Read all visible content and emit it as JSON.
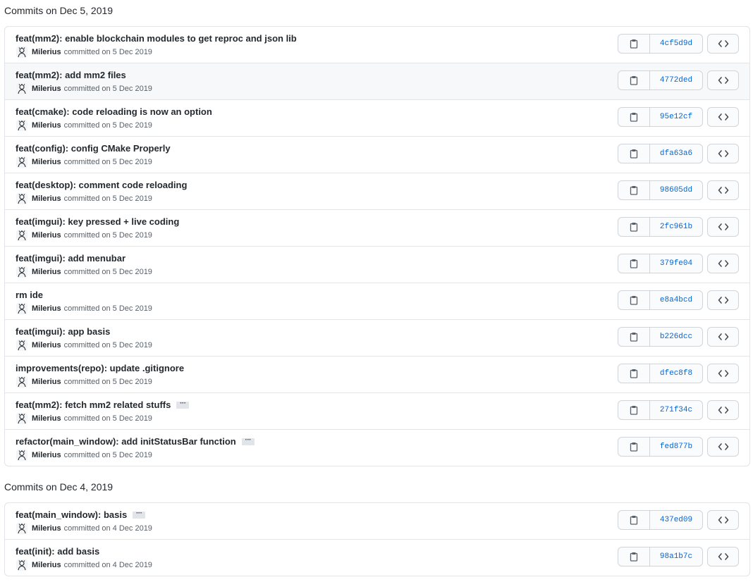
{
  "groups": [
    {
      "title": "Commits on Dec 5, 2019",
      "commits": [
        {
          "message": "feat(mm2): enable blockchain modules to get reproc and json lib",
          "author": "Milerius",
          "committed": "committed on 5 Dec 2019",
          "sha": "4cf5d9d",
          "ellipsis": false,
          "highlight": false
        },
        {
          "message": "feat(mm2): add mm2 files",
          "author": "Milerius",
          "committed": "committed on 5 Dec 2019",
          "sha": "4772ded",
          "ellipsis": false,
          "highlight": true
        },
        {
          "message": "feat(cmake): code reloading is now an option",
          "author": "Milerius",
          "committed": "committed on 5 Dec 2019",
          "sha": "95e12cf",
          "ellipsis": false,
          "highlight": false
        },
        {
          "message": "feat(config): config CMake Properly",
          "author": "Milerius",
          "committed": "committed on 5 Dec 2019",
          "sha": "dfa63a6",
          "ellipsis": false,
          "highlight": false
        },
        {
          "message": "feat(desktop): comment code reloading",
          "author": "Milerius",
          "committed": "committed on 5 Dec 2019",
          "sha": "98605dd",
          "ellipsis": false,
          "highlight": false
        },
        {
          "message": "feat(imgui): key pressed + live coding",
          "author": "Milerius",
          "committed": "committed on 5 Dec 2019",
          "sha": "2fc961b",
          "ellipsis": false,
          "highlight": false
        },
        {
          "message": "feat(imgui): add menubar",
          "author": "Milerius",
          "committed": "committed on 5 Dec 2019",
          "sha": "379fe04",
          "ellipsis": false,
          "highlight": false
        },
        {
          "message": "rm ide",
          "author": "Milerius",
          "committed": "committed on 5 Dec 2019",
          "sha": "e8a4bcd",
          "ellipsis": false,
          "highlight": false
        },
        {
          "message": "feat(imgui): app basis",
          "author": "Milerius",
          "committed": "committed on 5 Dec 2019",
          "sha": "b226dcc",
          "ellipsis": false,
          "highlight": false
        },
        {
          "message": "improvements(repo): update .gitignore",
          "author": "Milerius",
          "committed": "committed on 5 Dec 2019",
          "sha": "dfec8f8",
          "ellipsis": false,
          "highlight": false
        },
        {
          "message": "feat(mm2): fetch mm2 related stuffs",
          "author": "Milerius",
          "committed": "committed on 5 Dec 2019",
          "sha": "271f34c",
          "ellipsis": true,
          "highlight": false
        },
        {
          "message": "refactor(main_window): add initStatusBar function",
          "author": "Milerius",
          "committed": "committed on 5 Dec 2019",
          "sha": "fed877b",
          "ellipsis": true,
          "highlight": false
        }
      ]
    },
    {
      "title": "Commits on Dec 4, 2019",
      "commits": [
        {
          "message": "feat(main_window): basis",
          "author": "Milerius",
          "committed": "committed on 4 Dec 2019",
          "sha": "437ed09",
          "ellipsis": true,
          "highlight": false
        },
        {
          "message": "feat(init): add basis",
          "author": "Milerius",
          "committed": "committed on 4 Dec 2019",
          "sha": "98a1b7c",
          "ellipsis": false,
          "highlight": false
        }
      ]
    }
  ],
  "icons": {
    "copy": "clipboard-icon",
    "browse": "code-icon",
    "avatar": "avatar-icon",
    "ellipsis_text": "···"
  },
  "colors": {
    "sha": "#0366d6",
    "border": "#e1e4e8",
    "highlight": "#f6f8fa"
  }
}
